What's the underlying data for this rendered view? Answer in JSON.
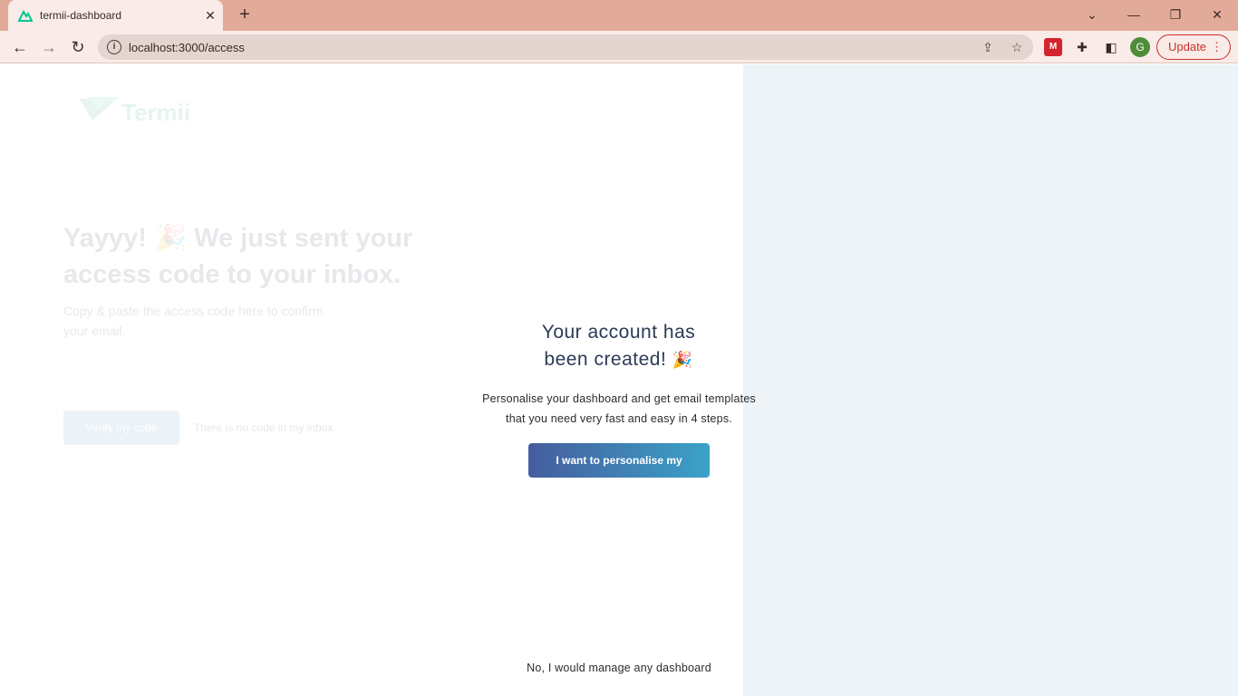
{
  "browser": {
    "tab_title": "termii-dashboard",
    "url": "localhost:3000/access",
    "update_label": "Update",
    "profile_initial": "G"
  },
  "background": {
    "logo_text": "Termii",
    "title": "Yayyy! 🎉 We just sent your access code to your inbox.",
    "subtitle": "Copy & paste the access code here to confirm your email.",
    "verify_label": "Verify my code",
    "no_code_label": "There is no code in my inbox"
  },
  "modal": {
    "title_line1": "Your account has",
    "title_line2": "been created!",
    "emoji": "🎉",
    "description_line1": "Personalise your dashboard and get email templates",
    "description_line2": "that you need very fast and easy in 4 steps.",
    "cta_label": "I want to personalise my dashboard",
    "skip_label": "No, I would manage any dashboard"
  },
  "colors": {
    "accent_start": "#465c9e",
    "accent_end": "#3aa2c8",
    "panel_bg": "#eef3f7"
  }
}
